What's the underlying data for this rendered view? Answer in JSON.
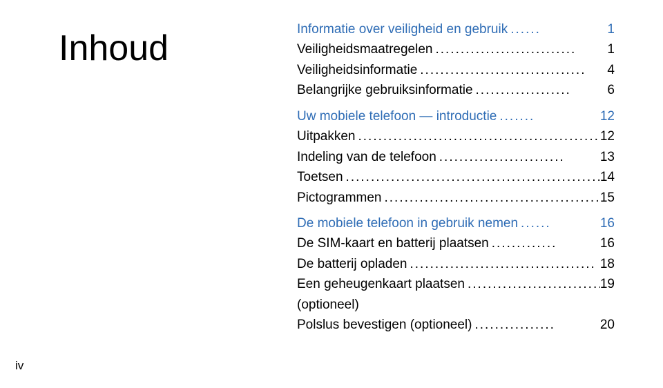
{
  "title": "Inhoud",
  "page_number": "iv",
  "toc": [
    {
      "label": "Informatie over veiligheid en gebruik",
      "page": "1",
      "section": true
    },
    {
      "label": "Veiligheidsmaatregelen",
      "page": "1",
      "section": false
    },
    {
      "label": "Veiligheidsinformatie",
      "page": "4",
      "section": false
    },
    {
      "label": "Belangrijke gebruiksinformatie",
      "page": "6",
      "section": false
    },
    {
      "label": "Uw mobiele telefoon — introductie",
      "page": "12",
      "section": true
    },
    {
      "label": "Uitpakken",
      "page": "12",
      "section": false
    },
    {
      "label": "Indeling van de telefoon",
      "page": "13",
      "section": false
    },
    {
      "label": "Toetsen",
      "page": "14",
      "section": false
    },
    {
      "label": "Pictogrammen",
      "page": "15",
      "section": false
    },
    {
      "label": "De mobiele telefoon in gebruik nemen",
      "page": "16",
      "section": true
    },
    {
      "label": "De SIM-kaart en batterij plaatsen",
      "page": "16",
      "section": false
    },
    {
      "label": "De batterij opladen",
      "page": "18",
      "section": false
    },
    {
      "label": "Een geheugenkaart plaatsen (optioneel)",
      "page": "19",
      "section": false
    },
    {
      "label": "Polslus bevestigen (optioneel)",
      "page": "20",
      "section": false
    }
  ]
}
